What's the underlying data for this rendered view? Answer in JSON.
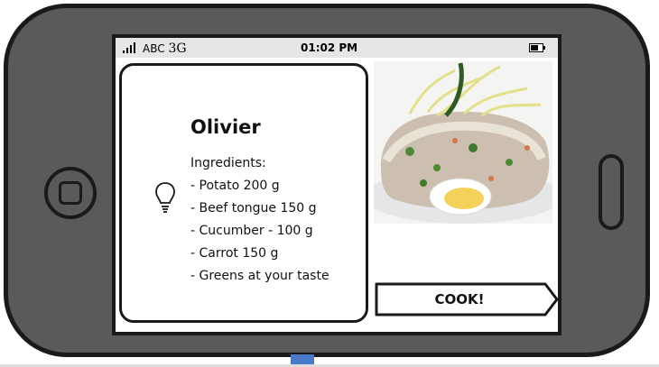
{
  "status_bar": {
    "carrier": "ABC",
    "network": "3G",
    "time": "01:02 PM"
  },
  "recipe": {
    "title": "Olivier",
    "ingredients_heading": "Ingredients:",
    "ingredients": [
      "- Potato 200 g",
      "- Beef tongue 150 g",
      "- Cucumber - 100 g",
      "- Carrot 150 g",
      "- Greens at your taste"
    ]
  },
  "actions": {
    "cook_label": "COOK!"
  },
  "icons": {
    "bulb": "lightbulb-icon",
    "signal": "signal-strength-icon",
    "battery": "battery-icon"
  }
}
